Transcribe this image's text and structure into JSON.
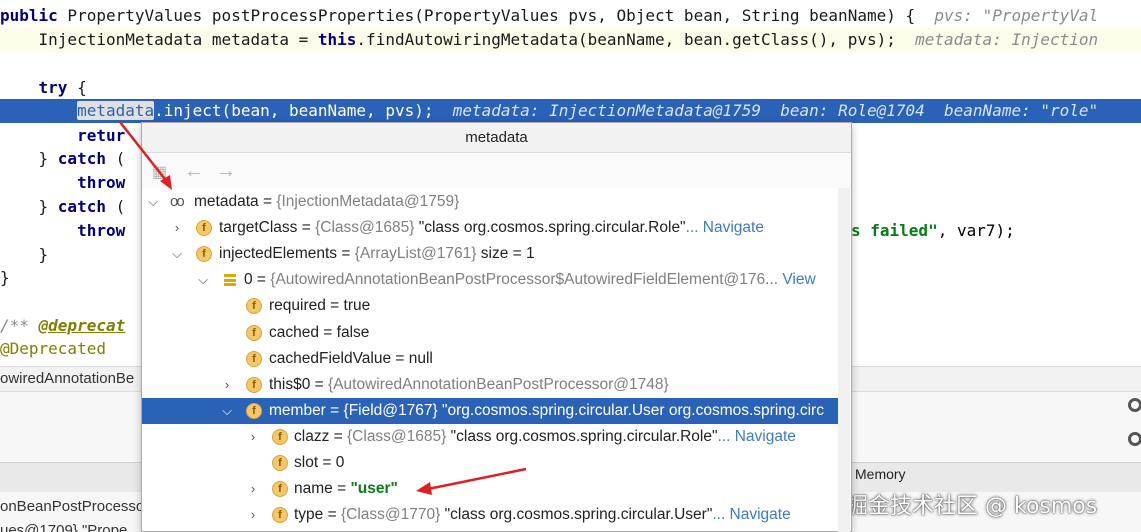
{
  "editor": {
    "lines": [
      {
        "kw": "public",
        "code": " PropertyValues postProcessProperties(PropertyValues pvs, Object bean, String beanName) {",
        "hint": "  pvs: \"PropertyVal"
      },
      {
        "indent": "    ",
        "code": "InjectionMetadata metadata = ",
        "kw2": "this",
        "code2": ".findAutowiringMetadata(beanName, bean.getClass(), pvs);",
        "hint": "  metadata: Injection"
      },
      {
        "blank": ""
      },
      {
        "indent": "    ",
        "kw": "try",
        "code": " {"
      },
      {
        "indent": "        ",
        "selected": "metadata",
        "code": ".inject(bean, beanName, pvs);",
        "hint": "  metadata: InjectionMetadata@1759  bean: Role@1704  beanName: \"role\""
      },
      {
        "indent": "        ",
        "kw": "retur"
      },
      {
        "indent": "    ",
        "code": "} ",
        "kw": "catch",
        "code2": " ("
      },
      {
        "indent": "        ",
        "kw": "throw"
      },
      {
        "indent": "    ",
        "code": "} ",
        "kw": "catch",
        "code2": " ("
      },
      {
        "indent": "        ",
        "kw": "throw",
        "tail_str": "s failed\"",
        "tail": ", var7);"
      },
      {
        "indent": "    ",
        "code": "}"
      },
      {
        "code": "}"
      },
      {
        "blank": ""
      },
      {
        "comment": "/** ",
        "deprec": "@deprecat"
      },
      {
        "annotation": "@Deprecated"
      }
    ]
  },
  "lower_panel": {
    "strip_text": "owiredAnnotationBe",
    "item1": "onBeanPostProcesso",
    "item2": "ues@1709} \"Prope",
    "memory_tab": "Memory",
    "watermark": "掘金技术社区 @ kosmos"
  },
  "popup": {
    "title": "metadata",
    "toolbar": {
      "back": "←",
      "forward": "→"
    },
    "rows": [
      {
        "name": "metadata",
        "eq": " = ",
        "type": "{InjectionMetadata@1759}",
        "value": "",
        "nav": ""
      },
      {
        "name": "targetClass",
        "eq": " = ",
        "type": "{Class@1685} ",
        "value": "\"class org.cosmos.spring.circular.Role\"",
        "nav": "... Navigate"
      },
      {
        "name": "injectedElements",
        "eq": " = ",
        "type": "{ArrayList@1761} ",
        "value": " size = 1",
        "nav": ""
      },
      {
        "name": "0",
        "eq": " = ",
        "type": "{AutowiredAnnotationBeanPostProcessor$AutowiredFieldElement@176",
        "value": "",
        "nav": "... View"
      },
      {
        "name": "required",
        "eq": " = ",
        "type": "",
        "value": "true",
        "nav": ""
      },
      {
        "name": "cached",
        "eq": " = ",
        "type": "",
        "value": "false",
        "nav": ""
      },
      {
        "name": "cachedFieldValue",
        "eq": " = ",
        "type": "",
        "value": "null",
        "nav": ""
      },
      {
        "name": "this$0",
        "eq": " = ",
        "type": "{AutowiredAnnotationBeanPostProcessor@1748}",
        "value": "",
        "nav": ""
      },
      {
        "name": "member",
        "eq": " = ",
        "type": "{Field@1767} ",
        "value": "\"org.cosmos.spring.circular.User org.cosmos.spring.circ",
        "nav": ""
      },
      {
        "name": "clazz",
        "eq": " = ",
        "type": "{Class@1685} ",
        "value": "\"class org.cosmos.spring.circular.Role\"",
        "nav": "... Navigate"
      },
      {
        "name": "slot",
        "eq": " = ",
        "type": "",
        "value": "0",
        "nav": ""
      },
      {
        "name": "name",
        "eq": " = ",
        "type": "",
        "value": "\"user\"",
        "nav": ""
      },
      {
        "name": "type",
        "eq": " = ",
        "type": "{Class@1770} ",
        "value": "\"class org.cosmos.spring.circular.User\"",
        "nav": "... Navigate"
      }
    ],
    "badge_letter": "f"
  },
  "colors": {
    "selection": "#2a62b8",
    "annotation_arrow": "#e02020",
    "string_green": "#067d17",
    "navigate": "#3d7bc8"
  }
}
